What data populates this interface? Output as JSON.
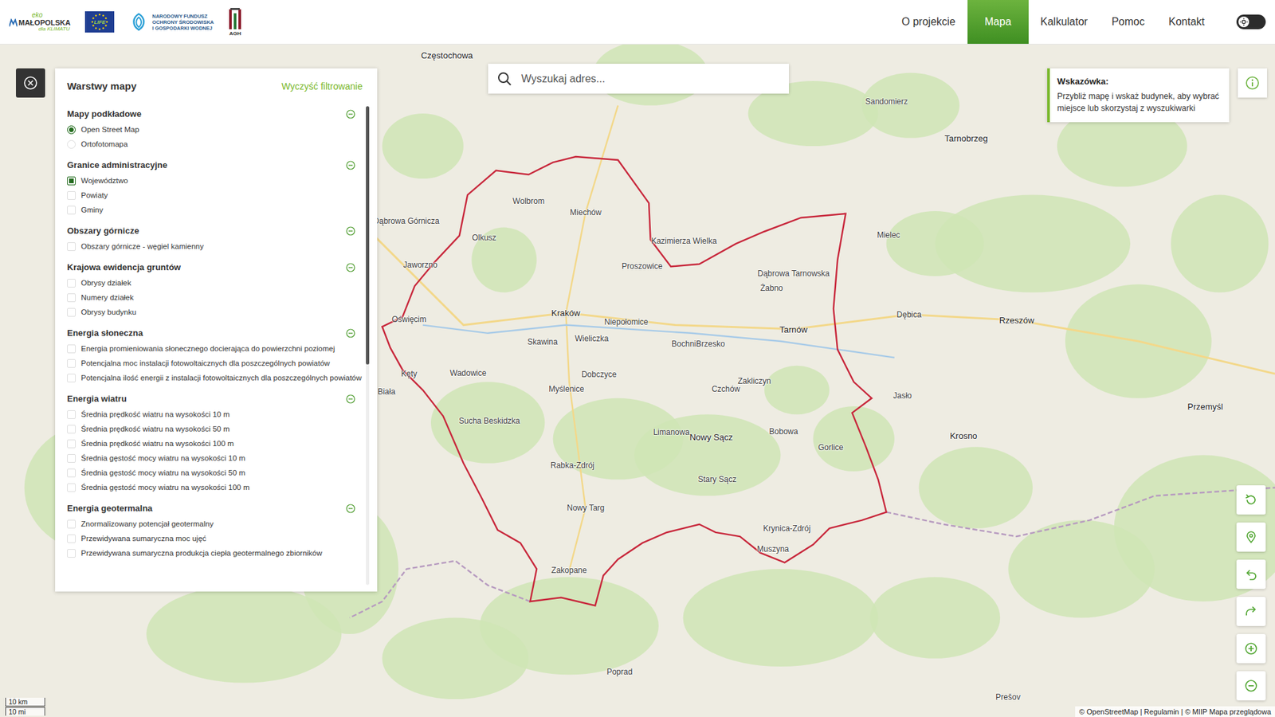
{
  "header": {
    "logo": {
      "eko": "eko",
      "name": "MAŁOPOLSKA",
      "claim": "dla KLIMATU",
      "eu": "LIFE",
      "nfos": [
        "NARODOWY FUNDUSZ",
        "OCHRONY ŚRODOWISKA",
        "I GOSPODARKI WODNEJ"
      ],
      "agh": "AGH"
    },
    "nav": [
      {
        "label": "O projekcie",
        "selected": false
      },
      {
        "label": "Mapa",
        "selected": true
      },
      {
        "label": "Kalkulator",
        "selected": false
      },
      {
        "label": "Pomoc",
        "selected": false
      },
      {
        "label": "Kontakt",
        "selected": false
      }
    ],
    "theme_toggle": {
      "on": false
    }
  },
  "layers_panel": {
    "title": "Warstwy mapy",
    "clear": "Wyczyść filtrowanie",
    "scrollbar": {
      "level": 0.54
    },
    "sections": [
      {
        "title": "Mapy podkładowe",
        "expanded": true,
        "items": [
          {
            "label": "Open Street Map",
            "kind": "radio",
            "checked": true
          },
          {
            "label": "Ortofotomapa",
            "kind": "radio",
            "checked": false
          }
        ]
      },
      {
        "title": "Granice administracyjne",
        "expanded": true,
        "items": [
          {
            "label": "Województwo",
            "kind": "checkbox",
            "checked": true
          },
          {
            "label": "Powiaty",
            "kind": "checkbox",
            "checked": false
          },
          {
            "label": "Gminy",
            "kind": "checkbox",
            "checked": false
          }
        ]
      },
      {
        "title": "Obszary górnicze",
        "expanded": true,
        "items": [
          {
            "label": "Obszary górnicze - węgiel kamienny",
            "kind": "checkbox",
            "checked": false
          }
        ]
      },
      {
        "title": "Krajowa ewidencja gruntów",
        "expanded": true,
        "items": [
          {
            "label": "Obrysy działek",
            "kind": "checkbox",
            "checked": false
          },
          {
            "label": "Numery działek",
            "kind": "checkbox",
            "checked": false
          },
          {
            "label": "Obrysy budynku",
            "kind": "checkbox",
            "checked": false
          }
        ]
      },
      {
        "title": "Energia słoneczna",
        "expanded": true,
        "items": [
          {
            "label": "Energia promieniowania słonecznego docierająca do powierzchni poziomej",
            "kind": "checkbox",
            "checked": false
          },
          {
            "label": "Potencjalna moc instalacji fotowoltaicznych dla poszczególnych powiatów",
            "kind": "checkbox",
            "checked": false
          },
          {
            "label": "Potencjalna ilość energii z instalacji fotowoltaicznych dla poszczególnych powiatów",
            "kind": "checkbox",
            "checked": false
          }
        ]
      },
      {
        "title": "Energia wiatru",
        "expanded": true,
        "items": [
          {
            "label": "Średnia prędkość wiatru na wysokości 10 m",
            "kind": "checkbox",
            "checked": false
          },
          {
            "label": "Średnia prędkość wiatru na wysokości 50 m",
            "kind": "checkbox",
            "checked": false
          },
          {
            "label": "Średnia prędkość wiatru na wysokości 100 m",
            "kind": "checkbox",
            "checked": false
          },
          {
            "label": "Średnia gęstość mocy wiatru na wysokości 10 m",
            "kind": "checkbox",
            "checked": false
          },
          {
            "label": "Średnia gęstość mocy wiatru na wysokości 50 m",
            "kind": "checkbox",
            "checked": false
          },
          {
            "label": "Średnia gęstość mocy wiatru na wysokości 100 m",
            "kind": "checkbox",
            "checked": false
          }
        ]
      },
      {
        "title": "Energia geotermalna",
        "expanded": true,
        "items": [
          {
            "label": "Znormalizowany potencjał geotermalny",
            "kind": "checkbox",
            "checked": false
          },
          {
            "label": "Przewidywana sumaryczna moc ujęć",
            "kind": "checkbox",
            "checked": false
          },
          {
            "label": "Przewidywana sumaryczna produkcja ciepła geotermalnego zbiorników",
            "kind": "checkbox",
            "checked": false
          }
        ]
      }
    ]
  },
  "search": {
    "placeholder": "Wyszukaj adres..."
  },
  "hint": {
    "title": "Wskazówka:",
    "text": "Przybliż mapę i wskaż budynek, aby wybrać miejsce lub skorzystaj z wyszukiwarki"
  },
  "map": {
    "labels": [
      "Częstochowa",
      "Sandomierz",
      "Tarnobrzeg",
      "Dąbrowa Górnicza",
      "Wolbrom",
      "Miechów",
      "Olkusz",
      "Jaworzno",
      "Kazimierza Wielka",
      "Mielec",
      "Proszowice",
      "Dąbrowa Tarnowska",
      "Żabno",
      "Kraków",
      "Niepołomice",
      "Oświęcim",
      "Dębica",
      "Rzeszów",
      "Tarnów",
      "Wieliczka",
      "Skawina",
      "Bochnia",
      "Brzesko",
      "Kęty",
      "Wadowice",
      "Dobczyce",
      "Zakliczyn",
      "Czchów",
      "Myślenice",
      "Biała",
      "Przemyśl",
      "Jasło",
      "Sucha Beskidzka",
      "Bobowa",
      "Limanowa",
      "Nowy Sącz",
      "Krosno",
      "Gorlice",
      "Rabka-Zdrój",
      "Stary Sącz",
      "Nowy Targ",
      "Krynica-Zdrój",
      "Muszyna",
      "Zakopane",
      "Poprad",
      "Prešov"
    ],
    "scale": [
      "10 km",
      "10 mi"
    ],
    "attribution": "© OpenStreetMap | Regulamin | © MIIP Mapa przeglądowa"
  }
}
